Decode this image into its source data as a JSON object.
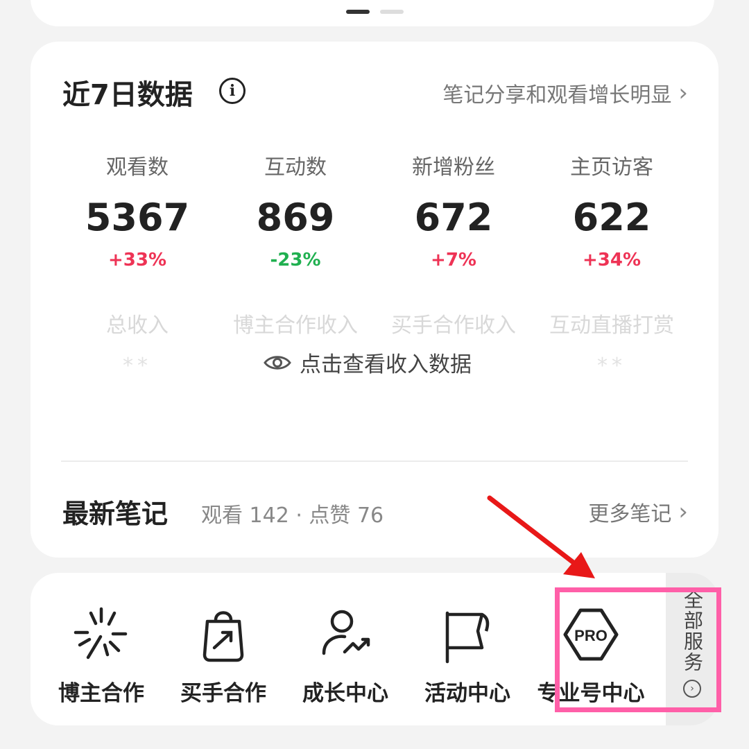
{
  "stats_section": {
    "title": "近7日数据",
    "info_icon": "info-icon",
    "trend_text": "笔记分享和观看增长明显",
    "metrics": [
      {
        "label": "观看数",
        "value": "5367",
        "change": "+33%",
        "direction": "up"
      },
      {
        "label": "互动数",
        "value": "869",
        "change": "-23%",
        "direction": "down"
      },
      {
        "label": "新增粉丝",
        "value": "672",
        "change": "+7%",
        "direction": "up"
      },
      {
        "label": "主页访客",
        "value": "622",
        "change": "+34%",
        "direction": "up"
      }
    ],
    "income_labels": [
      "总收入",
      "博主合作收入",
      "买手合作收入",
      "互动直播打赏"
    ],
    "income_mask": "**",
    "view_income_text": "点击查看收入数据"
  },
  "latest_notes": {
    "title": "最新笔记",
    "stats": "观看 142 · 点赞 76",
    "more": "更多笔记"
  },
  "services": {
    "items": [
      {
        "label": "博主合作",
        "icon": "sparkle-icon"
      },
      {
        "label": "买手合作",
        "icon": "shopping-bag-icon"
      },
      {
        "label": "成长中心",
        "icon": "growth-person-icon"
      },
      {
        "label": "活动中心",
        "icon": "flag-icon"
      },
      {
        "label": "专业号中心",
        "icon": "pro-badge-icon",
        "badge": "PRO"
      }
    ],
    "all_services": "全部服务"
  },
  "colors": {
    "up": "#ee3355",
    "down": "#20b050",
    "highlight": "#ff5fa8",
    "arrow": "#e81818"
  }
}
